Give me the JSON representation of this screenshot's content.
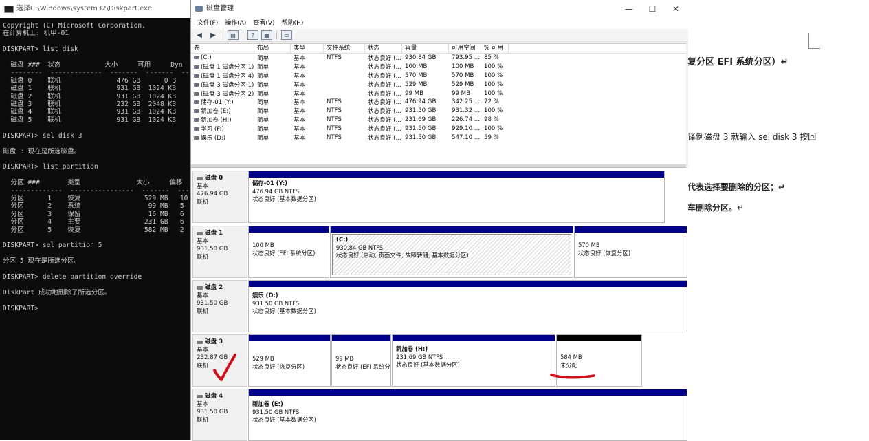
{
  "doc": {
    "lines": [
      "复分区 EFI 系统分区）↵",
      "译例磁盘 3 就输入 sel disk 3 按回",
      "代表选择要删除的分区；↵",
      "车删除分区。↵"
    ]
  },
  "cmd": {
    "title": "选择C:\\Windows\\system32\\Diskpart.exe",
    "console": "Copyright (C) Microsoft Corporation.\n在计算机上: 机甲-01\n\nDISKPART> list disk\n\n  磁盘 ###  状态           大小     可用     Dyn\n  --------  -------------  -------  -------  ---\n  磁盘 0    联机              476 GB      0 B\n  磁盘 1    联机              931 GB  1024 KB\n  磁盘 2    联机              931 GB  1024 KB\n  磁盘 3    联机              232 GB  2048 KB\n  磁盘 4    联机              931 GB  1024 KB\n  磁盘 5    联机              931 GB  1024 KB\n\nDISKPART> sel disk 3\n\n磁盘 3 现在是所选磁盘。\n\nDISKPART> list partition\n\n  分区 ###       类型              大小     偏移\n  -------------  ----------------  -------  -------\n  分区      1    恢复                529 MB   10\n  分区      2    系统                 99 MB   5\n  分区      3    保留                 16 MB   6\n  分区      4    主要                231 GB   6\n  分区      5    恢复                582 MB   2\n\nDISKPART> sel partition 5\n\n分区 5 现在是所选分区。\n\nDISKPART> delete partition override\n\nDiskPart 成功地删除了所选分区。\n\nDISKPART>"
  },
  "dm": {
    "title": "磁盘管理",
    "window_buttons": {
      "minimize": "—",
      "maximize": "☐",
      "close": "✕"
    },
    "menu": [
      "文件(F)",
      "操作(A)",
      "查看(V)",
      "帮助(H)"
    ],
    "columns": [
      "卷",
      "布局",
      "类型",
      "文件系统",
      "状态",
      "容量",
      "可用空间",
      "% 可用"
    ],
    "volumes": [
      [
        "(C:)",
        "简单",
        "基本",
        "NTFS",
        "状态良好 (...",
        "930.84 GB",
        "793.95 ...",
        "85 %"
      ],
      [
        "(磁盘 1 磁盘分区 1)",
        "简单",
        "基本",
        "",
        "状态良好 (...",
        "100 MB",
        "100 MB",
        "100 %"
      ],
      [
        "(磁盘 1 磁盘分区 4)",
        "简单",
        "基本",
        "",
        "状态良好 (...",
        "570 MB",
        "570 MB",
        "100 %"
      ],
      [
        "(磁盘 3 磁盘分区 1)",
        "简单",
        "基本",
        "",
        "状态良好 (...",
        "529 MB",
        "529 MB",
        "100 %"
      ],
      [
        "(磁盘 3 磁盘分区 2)",
        "简单",
        "基本",
        "",
        "状态良好 (...",
        "99 MB",
        "99 MB",
        "100 %"
      ],
      [
        "储存-01 (Y:)",
        "简单",
        "基本",
        "NTFS",
        "状态良好 (...",
        "476.94 GB",
        "342.25 ...",
        "72 %"
      ],
      [
        "新加卷 (E:)",
        "简单",
        "基本",
        "NTFS",
        "状态良好 (...",
        "931.50 GB",
        "931.32 ...",
        "100 %"
      ],
      [
        "新加卷 (H:)",
        "简单",
        "基本",
        "NTFS",
        "状态良好 (...",
        "231.69 GB",
        "226.74 ...",
        "98 %"
      ],
      [
        "学习 (F:)",
        "简单",
        "基本",
        "NTFS",
        "状态良好 (...",
        "931.50 GB",
        "929.10 ...",
        "100 %"
      ],
      [
        "娱乐 (D:)",
        "简单",
        "基本",
        "NTFS",
        "状态良好 (...",
        "931.50 GB",
        "547.10 ...",
        "59 %"
      ]
    ],
    "disks": [
      {
        "name": "磁盘 0",
        "type": "基本",
        "size": "476.94 GB",
        "status": "联机",
        "partitions": [
          {
            "name": "储存-01 (Y:)",
            "size": "476.94 GB NTFS",
            "status": "状态良好 (基本数据分区)"
          }
        ]
      },
      {
        "name": "磁盘 1",
        "type": "基本",
        "size": "931.50 GB",
        "status": "联机",
        "partitions": [
          {
            "name": "",
            "size": "100 MB",
            "status": "状态良好 (EFI 系统分区)"
          },
          {
            "name": "(C:)",
            "size": "930.84 GB NTFS",
            "status": "状态良好 (启动, 页面文件, 故障转储, 基本数据分区)"
          },
          {
            "name": "",
            "size": "570 MB",
            "status": "状态良好 (恢复分区)"
          }
        ]
      },
      {
        "name": "磁盘 2",
        "type": "基本",
        "size": "931.50 GB",
        "status": "联机",
        "partitions": [
          {
            "name": "娱乐 (D:)",
            "size": "931.50 GB NTFS",
            "status": "状态良好 (基本数据分区)"
          }
        ]
      },
      {
        "name": "磁盘 3",
        "type": "基本",
        "size": "232.87 GB",
        "status": "联机",
        "partitions": [
          {
            "name": "",
            "size": "529 MB",
            "status": "状态良好 (恢复分区)"
          },
          {
            "name": "",
            "size": "99 MB",
            "status": "状态良好 (EFI 系统分"
          },
          {
            "name": "新加卷 (H:)",
            "size": "231.69 GB NTFS",
            "status": "状态良好 (基本数据分区)"
          },
          {
            "name": "",
            "size": "584 MB",
            "status": "未分配"
          }
        ]
      },
      {
        "name": "磁盘 4",
        "type": "基本",
        "size": "931.50 GB",
        "status": "联机",
        "partitions": [
          {
            "name": "新加卷 (E:)",
            "size": "931.50 GB NTFS",
            "status": "状态良好 (基本数据分区)"
          }
        ]
      }
    ],
    "colors": {
      "primary_band": "#00008b",
      "unallocated_band": "#000000",
      "annotation": "#d0101a"
    }
  }
}
